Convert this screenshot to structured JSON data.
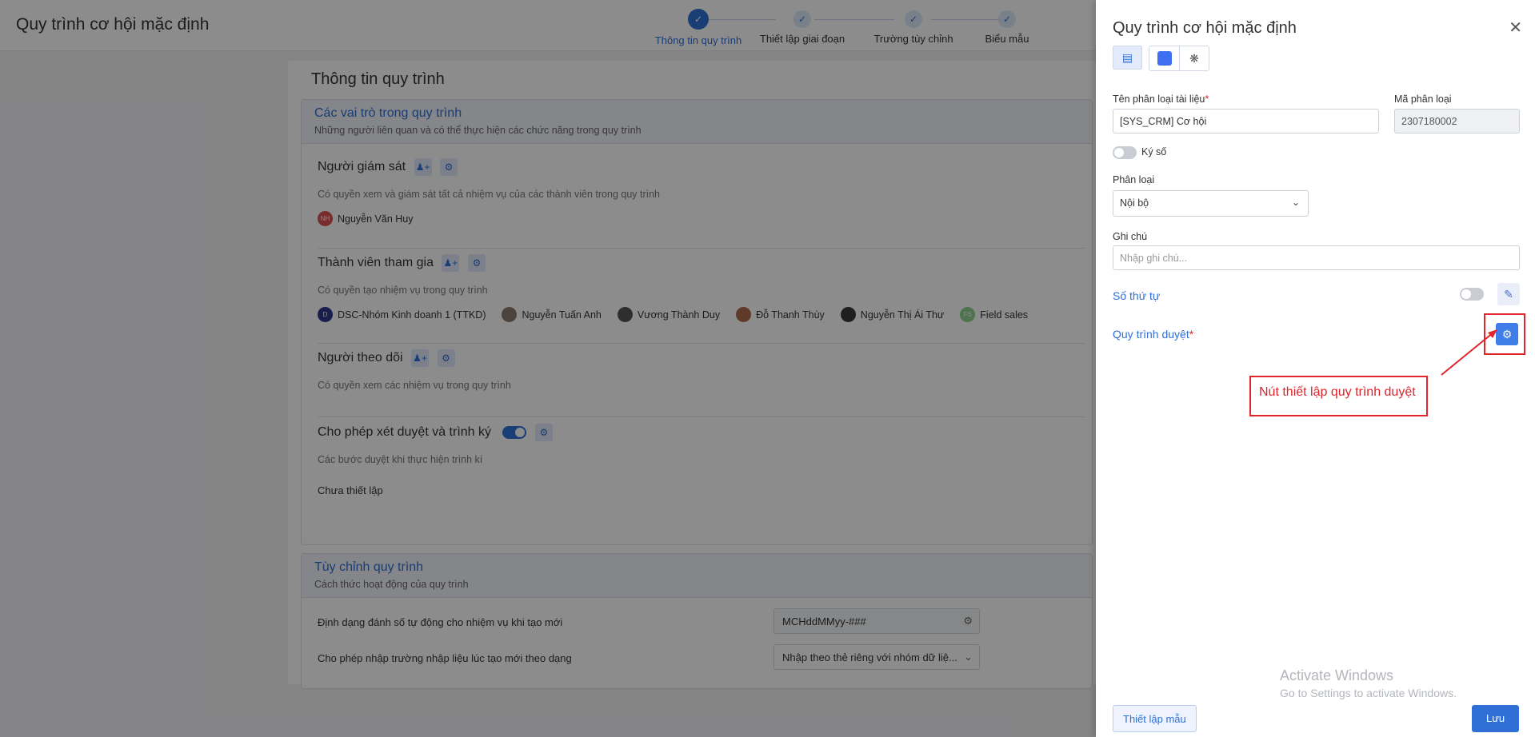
{
  "app": {
    "title": "Quy trình cơ hội mặc định"
  },
  "stepper": {
    "steps": [
      {
        "label": "Thông tin quy trình"
      },
      {
        "label": "Thiết lập giai đoạn"
      },
      {
        "label": "Trường tùy chỉnh"
      },
      {
        "label": "Biểu mẫu"
      }
    ],
    "check_glyph": "✓"
  },
  "main": {
    "page_title": "Thông tin quy trình",
    "roles_card": {
      "title": "Các vai trò trong quy trình",
      "subtitle": "Những người liên quan và có thể thực hiện các chức năng trong quy trình"
    },
    "supervisor": {
      "name": "Người giám sát",
      "desc": "Có quyền xem và giám sát tất cả nhiệm vụ của các thành viên trong quy trình",
      "people": [
        {
          "initials": "NH",
          "name": "Nguyễn Văn Huy",
          "color": "#d9534f"
        }
      ]
    },
    "members": {
      "name": "Thành viên tham gia",
      "desc": "Có quyền tạo nhiệm vụ trong quy trình",
      "people": [
        {
          "initials": "D",
          "name": "DSC-Nhóm Kinh doanh 1 (TTKD)",
          "color": "#2d3a8c"
        },
        {
          "initials": "",
          "name": "Nguyễn Tuấn Anh",
          "color": "#8a7a6e"
        },
        {
          "initials": "",
          "name": "Vương Thành Duy",
          "color": "#555555"
        },
        {
          "initials": "",
          "name": "Đỗ Thanh Thùy",
          "color": "#b06a4c"
        },
        {
          "initials": "",
          "name": "Nguyễn Thị Ái Thư",
          "color": "#3a3a3a"
        },
        {
          "initials": "FS",
          "name": "Field sales",
          "color": "#8fd18f"
        }
      ]
    },
    "followers": {
      "name": "Người theo dõi",
      "desc": "Có quyền xem các nhiệm vụ trong quy trình"
    },
    "approval": {
      "name": "Cho phép xét duyệt và trình ký",
      "desc": "Các bước duyệt khi thực hiện trình kí",
      "status": "Chưa thiết lập"
    },
    "custom_card": {
      "title": "Tùy chỉnh quy trình",
      "subtitle": "Cách thức hoạt động của quy trình",
      "rows": [
        {
          "label": "Định dạng đánh số tự động cho nhiệm vụ khi tạo mới",
          "value": "MCHddMMyy-###"
        },
        {
          "label": "Cho phép nhập trường nhập liệu lúc tạo mới theo dạng",
          "value": "Nhập theo thẻ riêng với nhóm dữ liệ..."
        }
      ]
    }
  },
  "drawer": {
    "title": "Quy trình cơ hội mặc định",
    "close_glyph": "✕",
    "accent_color": "#3f6ff1",
    "doc_type_name": {
      "label": "Tên phân loại tài liệu",
      "value": "[SYS_CRM] Cơ hội"
    },
    "doc_type_code": {
      "label": "Mã phân loại",
      "value": "2307180002"
    },
    "digital_sign": {
      "label": "Ký số"
    },
    "category": {
      "label": "Phân loại",
      "value": "Nội bộ"
    },
    "note": {
      "label": "Ghi chú",
      "placeholder": "Nhập ghi chú..."
    },
    "sequence": {
      "label": "Số thứ tự"
    },
    "approval_flow": {
      "label": "Quy trình duyệt"
    },
    "callout": "Nút thiết lập quy trình duyệt",
    "buttons": {
      "template": "Thiết lập mẫu",
      "save": "Lưu"
    }
  },
  "watermark": {
    "line1": "Activate Windows",
    "line2": "Go to Settings to activate Windows."
  }
}
